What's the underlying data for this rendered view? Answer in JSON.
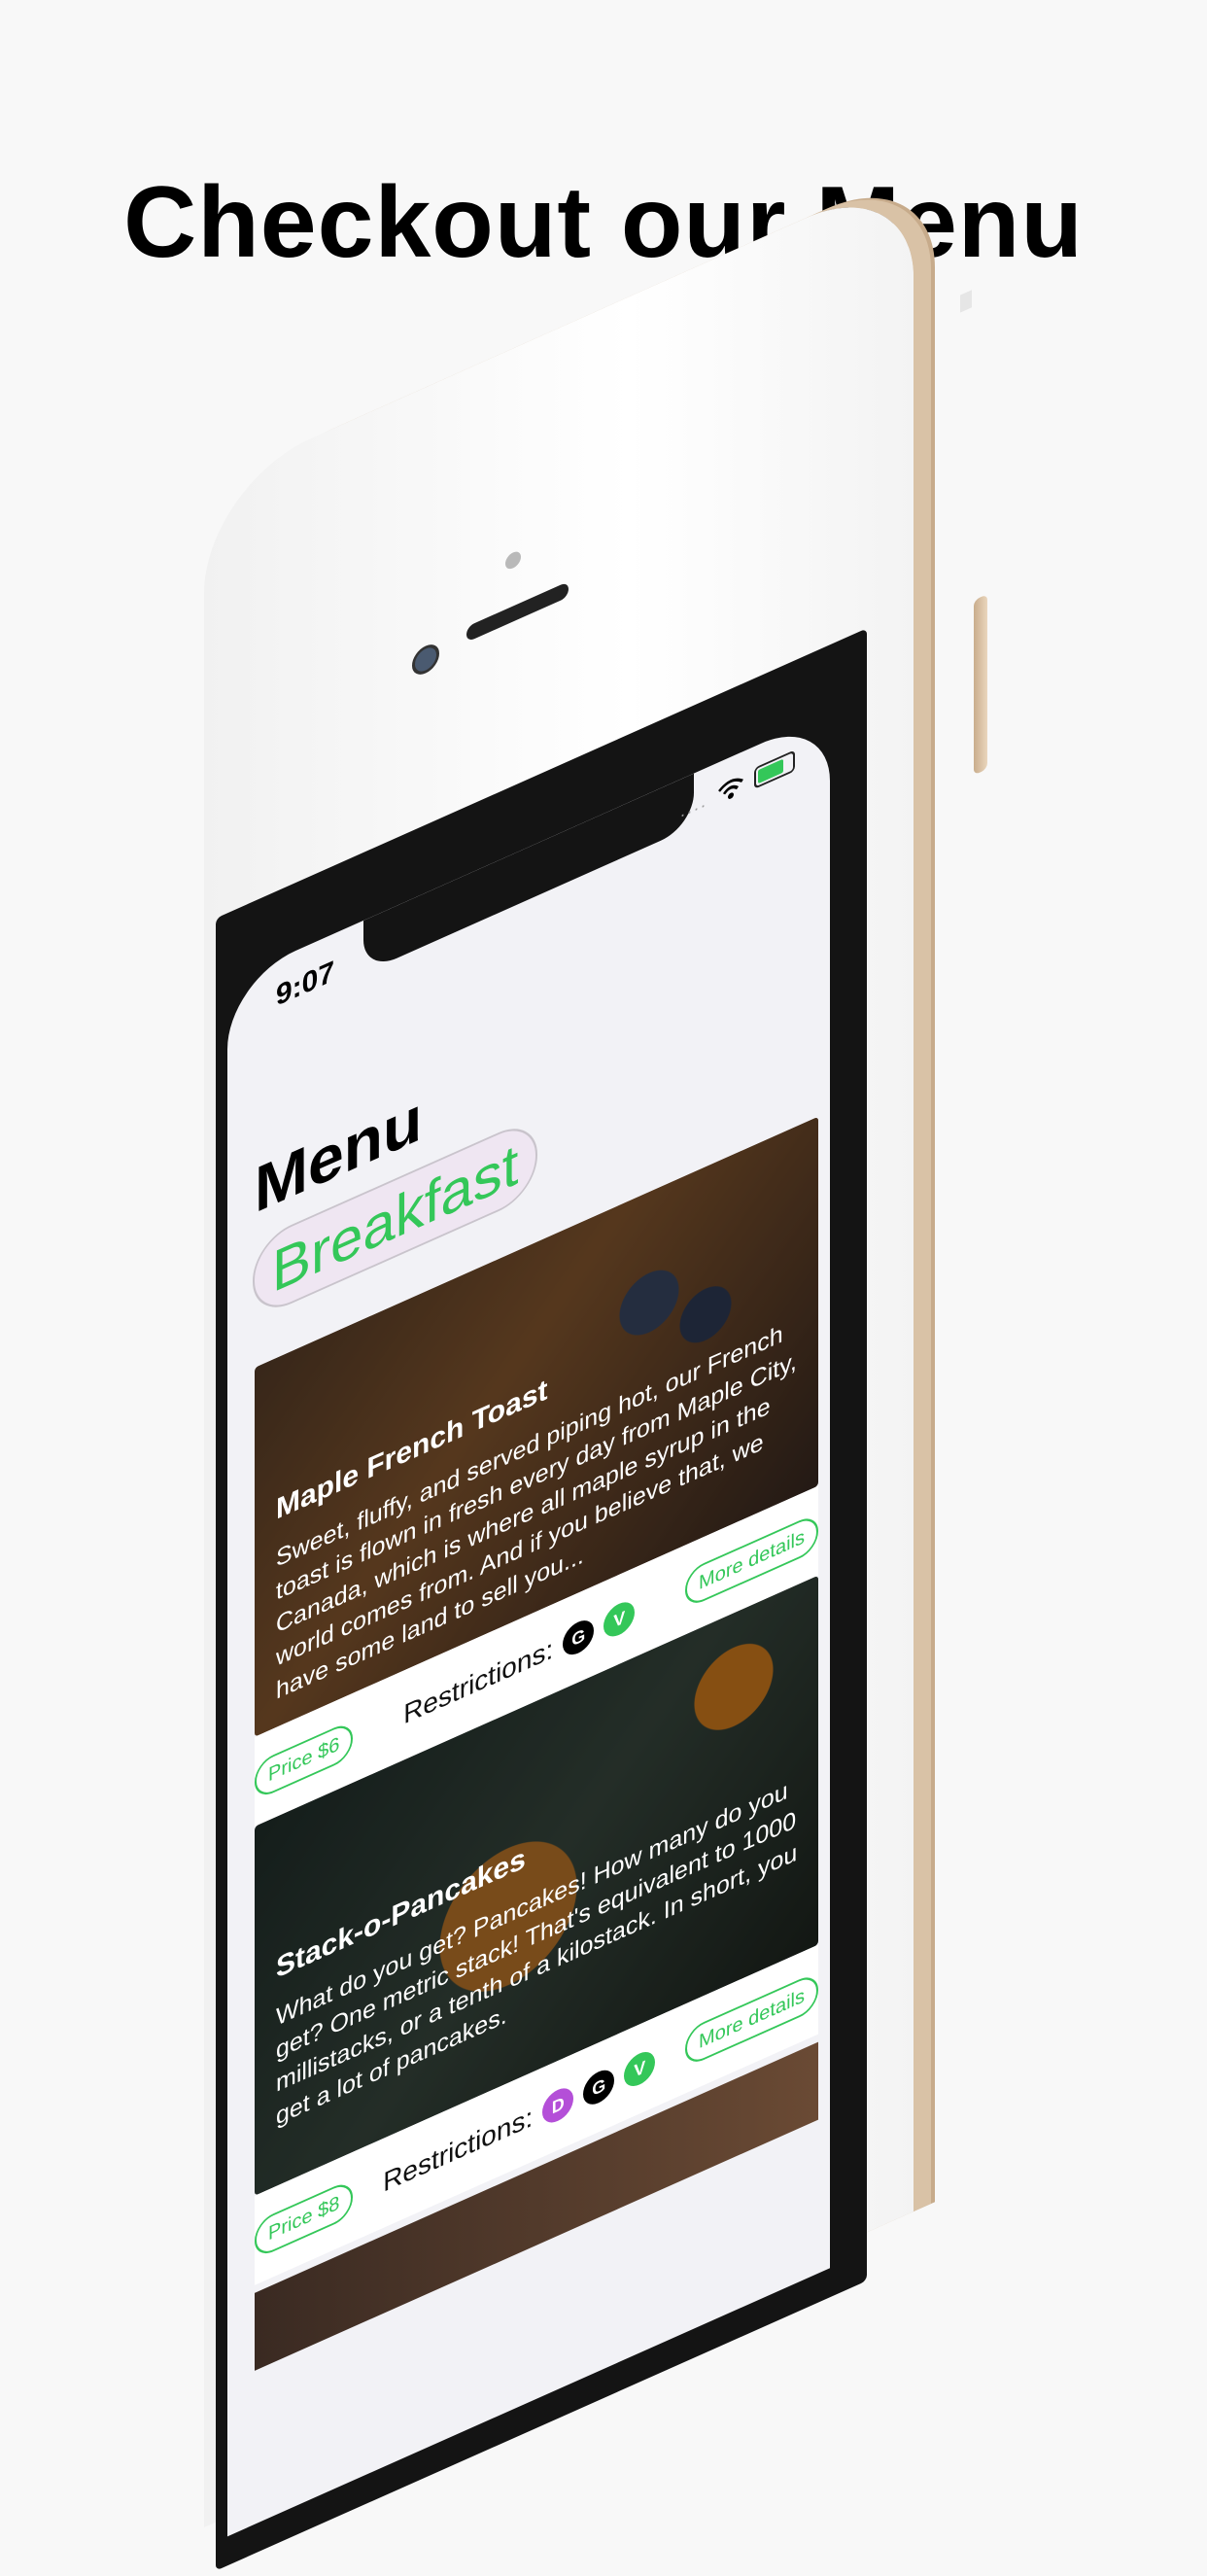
{
  "headline": "Checkout our Menu",
  "status_bar": {
    "time": "9:07",
    "signal": "....",
    "battery_color": "#34c759"
  },
  "page_title": "Menu",
  "category": "Breakfast",
  "accent_color": "#34c759",
  "items": [
    {
      "title": "Maple French Toast",
      "description": "Sweet, fluffy, and served piping hot, our French toast is flown in fresh every day from Maple City, Canada, which is where all maple syrup in the world comes from. And if you believe that, we have some land to sell you...",
      "price": "Price $6",
      "restrictions_label": "Restrictions:",
      "badges": [
        {
          "letter": "G",
          "color": "#000000"
        },
        {
          "letter": "V",
          "color": "#34c759"
        }
      ],
      "details_label": "More details"
    },
    {
      "title": "Stack-o-Pancakes",
      "description": "What do you get? Pancakes! How many do you get? One metric stack! That's equivalent to 1000 millistacks, or a tenth of a kilostack. In short, you get a lot of pancakes.",
      "price": "Price $8",
      "restrictions_label": "Restrictions:",
      "badges": [
        {
          "letter": "D",
          "color": "#b44fd8"
        },
        {
          "letter": "G",
          "color": "#000000"
        },
        {
          "letter": "V",
          "color": "#34c759"
        }
      ],
      "details_label": "More details"
    }
  ]
}
